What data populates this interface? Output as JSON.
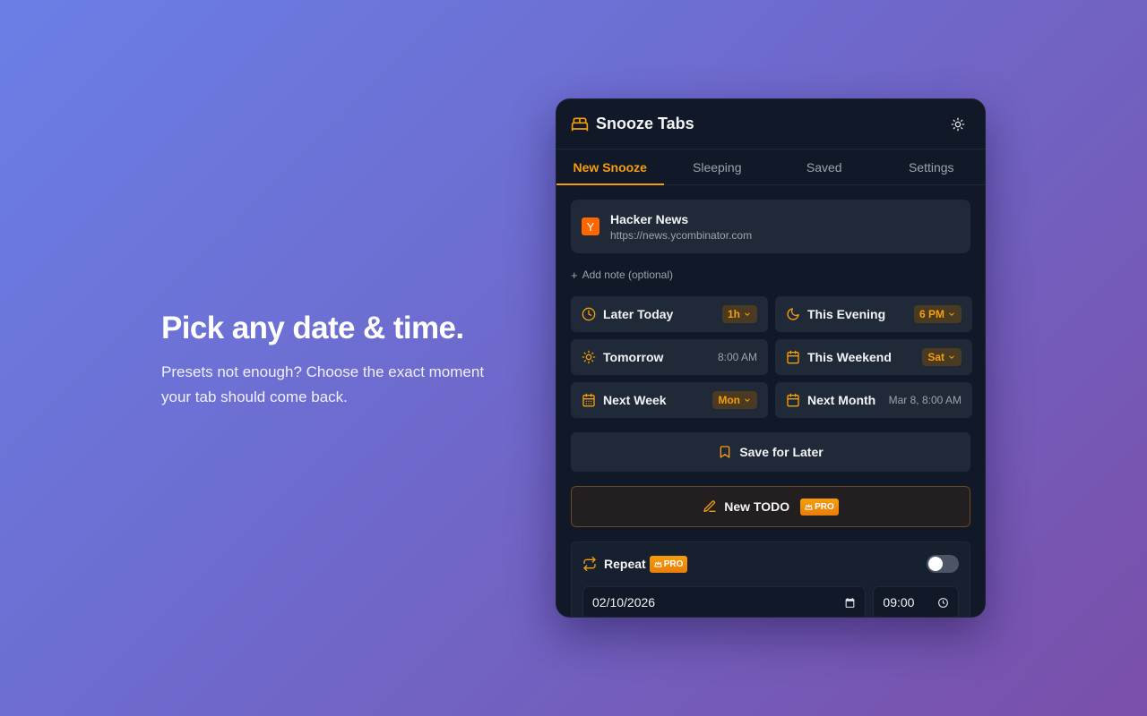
{
  "hero": {
    "headline": "Pick any date & time.",
    "subtext": "Presets not enough? Choose the exact moment your tab should come back."
  },
  "header": {
    "title": "Snooze Tabs",
    "logo_icon": "bed-icon",
    "theme_icon": "sun-icon"
  },
  "tabs": [
    {
      "label": "New Snooze",
      "active": true
    },
    {
      "label": "Sleeping",
      "active": false
    },
    {
      "label": "Saved",
      "active": false
    },
    {
      "label": "Settings",
      "active": false
    }
  ],
  "current_tab": {
    "favicon": "Y",
    "title": "Hacker News",
    "url": "https://news.ycombinator.com"
  },
  "add_note": "Add note (optional)",
  "options": [
    {
      "label": "Later Today",
      "icon": "clock-icon",
      "value": "1h",
      "style": "pill"
    },
    {
      "label": "This Evening",
      "icon": "moon-icon",
      "value": "6 PM",
      "style": "pill"
    },
    {
      "label": "Tomorrow",
      "icon": "sun-icon",
      "value": "8:00 AM",
      "style": "text"
    },
    {
      "label": "This Weekend",
      "icon": "calendar-icon",
      "value": "Sat",
      "style": "pill"
    },
    {
      "label": "Next Week",
      "icon": "calendar-grid-icon",
      "value": "Mon",
      "style": "pill"
    },
    {
      "label": "Next Month",
      "icon": "calendar-icon",
      "value": "Mar 8, 8:00 AM",
      "style": "text"
    }
  ],
  "save_button": "Save for Later",
  "todo_button": "New TODO",
  "pro_badge": "PRO",
  "repeat": {
    "label": "Repeat",
    "enabled": false,
    "date": "02/10/2026",
    "time": "09:00"
  },
  "colors": {
    "accent": "#f59e0b",
    "panel": "#111827",
    "card": "#1f2937",
    "hn_orange": "#ff6600"
  }
}
